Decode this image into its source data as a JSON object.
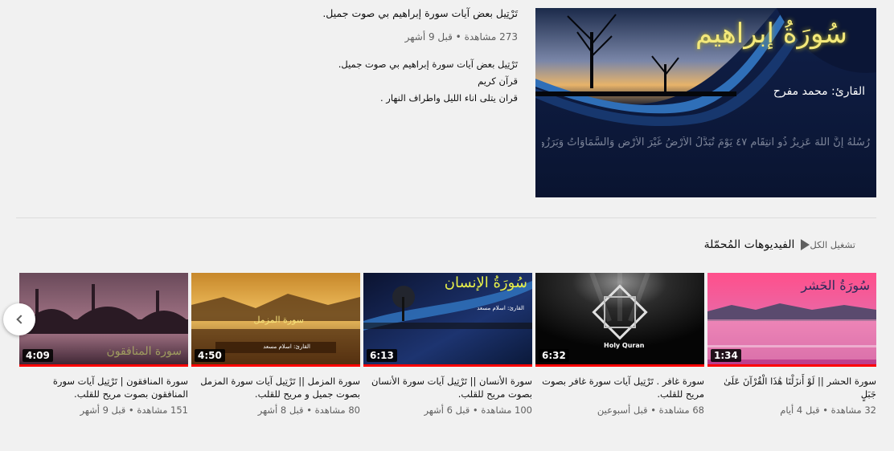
{
  "featured": {
    "thumbnail": {
      "title_art": "سُورَةُ إبراهيم",
      "reader_label": "القارئ: محمد مفرح",
      "verse_text": "رُسُلَهُ إِنَّ اللَّهَ عَزِيزٌ ذُو انتِقَامٍ ٤٧ يَوْمَ تُبَدَّلُ الْأَرْضُ غَيْرَ الْأَرْضِ وَالسَّمَاوَاتُ وَبَرَزُوا لِلَّهِ"
    },
    "title": "تَرْتِيل بعض آيات سورة إبراهيم بي صوت جميل.",
    "meta": "273 مشاهدة • قبل 9 أشهر",
    "description": [
      "تَرْتِيل بعض آيات سورة إبراهيم  بي صوت جميل.",
      "قرآن كريم",
      "قران يتلى اناء الليل واطراف النهار ."
    ]
  },
  "shelf": {
    "title": "الفيديوهات المُحمّلة",
    "play_all_label": "تشغيل الكل",
    "play_icon": "play-icon",
    "prev_icon": "chevron-left-icon"
  },
  "videos": [
    {
      "duration": "1:34",
      "title": "سورة الحشر || لَوْ أَنزَلْنَا هَٰذَا الْقُرْآنَ عَلَىٰ جَبَلٍ",
      "meta": "32 مشاهدة • قبل 4 أيام",
      "thumb_text": "سُورَةُ الحَشر",
      "watched_fraction": 1.0
    },
    {
      "duration": "6:32",
      "title": "سورة غافر . تَرْتِيل آيات سورة غافر بصوت مريح للقلب.",
      "meta": "68 مشاهدة • قبل أسبوعين",
      "thumb_text": "Holy Quran",
      "watched_fraction": 1.0
    },
    {
      "duration": "6:13",
      "title": "سورة الأنسان || تَرْتِيل آيات سورة الأنسان بصوت مريح للقلب.",
      "meta": "100 مشاهدة • قبل 6 أشهر",
      "thumb_text": "سُورَةُ الإنسان",
      "thumb_sub": "القارئ: اسلام مسعد",
      "watched_fraction": 1.0
    },
    {
      "duration": "4:50",
      "title": "سورة المزمل || تَرْتِيل آيات سورة المزمل بصوت جميل و مريح للقلب.",
      "meta": "80 مشاهدة • قبل 8 أشهر",
      "thumb_text": "سورة المزمل",
      "thumb_sub": "القارئ: اسلام مسعد",
      "watched_fraction": 1.0
    },
    {
      "duration": "4:09",
      "title": "سورة المنافقون | تَرْتِيل آيات سورة المنافقون بصوت مريح للقلب.",
      "meta": "151 مشاهدة • قبل 9 أشهر",
      "thumb_text": "سورة المنافقون",
      "watched_fraction": 1.0
    }
  ],
  "colors": {
    "background": "#f1f1f1",
    "progress": "#ff0000",
    "meta_text": "#606060",
    "title_text": "#0f0f0f"
  }
}
